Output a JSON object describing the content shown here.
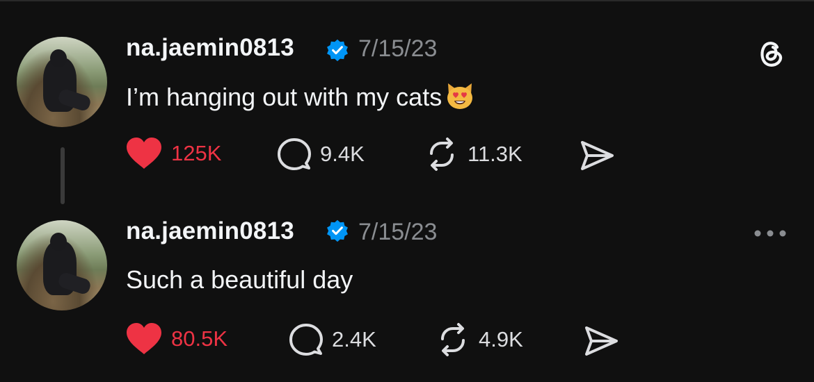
{
  "posts": [
    {
      "username": "na.jaemin0813",
      "date": "7/15/23",
      "text": "I’m hanging out with my cats",
      "emoji": "smiling-cat-heart-eyes",
      "likes": "125K",
      "replies": "9.4K",
      "reposts": "11.3K"
    },
    {
      "username": "na.jaemin0813",
      "date": "7/15/23",
      "text": "Such a beautiful day",
      "likes": "80.5K",
      "replies": "2.4K",
      "reposts": "4.9K"
    }
  ],
  "colors": {
    "background": "#101010",
    "like": "#ee3344",
    "verified": "#0095f6",
    "secondary_text": "#8a8d91"
  }
}
